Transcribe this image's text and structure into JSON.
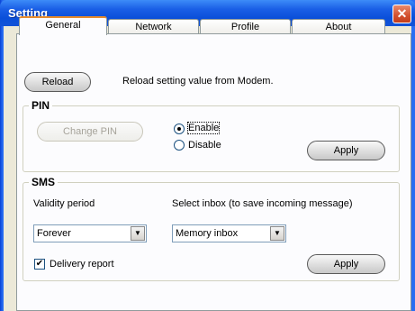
{
  "window": {
    "title": "Setting",
    "close_label": "✕"
  },
  "tabs": [
    "General",
    "Network",
    "Profile",
    "About"
  ],
  "reload": {
    "button_label": "Reload",
    "description": "Reload setting value from Modem."
  },
  "pin": {
    "group_label": "PIN",
    "change_button_label": "Change PIN",
    "enable_label": "Enable",
    "disable_label": "Disable",
    "selected": "Enable",
    "apply_label": "Apply"
  },
  "sms": {
    "group_label": "SMS",
    "validity_label": "Validity period",
    "inbox_label": "Select inbox (to save incoming message)",
    "validity_value": "Forever",
    "inbox_value": "Memory inbox",
    "delivery_label": "Delivery report",
    "delivery_checked": true,
    "apply_label": "Apply"
  }
}
